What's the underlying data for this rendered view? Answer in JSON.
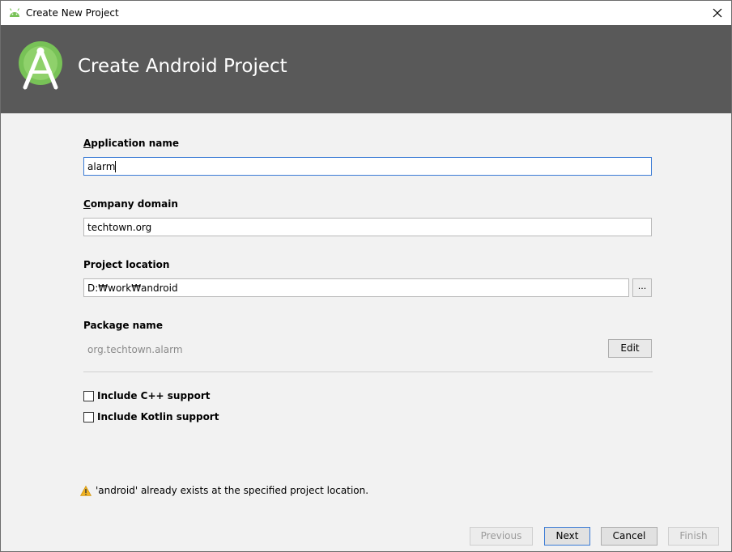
{
  "window": {
    "title": "Create New Project",
    "close_icon": "close-icon"
  },
  "header": {
    "heading": "Create Android Project",
    "logo_icon": "android-studio-logo"
  },
  "form": {
    "app_name_label_first": "A",
    "app_name_label_rest": "pplication name",
    "app_name_value": "alarm",
    "company_label_first": "C",
    "company_label_rest": "ompany domain",
    "company_value": "techtown.org",
    "location_label": "Project location",
    "location_value": "D:₩work₩android",
    "browse_label": "...",
    "package_label": "Package name",
    "package_value": "org.techtown.alarm",
    "edit_label": "Edit",
    "cpp_label": "Include C++ support",
    "cpp_checked": false,
    "kotlin_label": "Include Kotlin support",
    "kotlin_checked": false
  },
  "warning": {
    "icon": "warning-icon",
    "text": "'android' already exists at the specified project location."
  },
  "footer": {
    "previous_label": "Previous",
    "next_label": "Next",
    "cancel_label": "Cancel",
    "finish_label": "Finish"
  },
  "colors": {
    "header_bg": "#595959",
    "logo_green": "#78c257",
    "focus_border": "#3a7bd5",
    "warning_yellow": "#f0b323"
  }
}
